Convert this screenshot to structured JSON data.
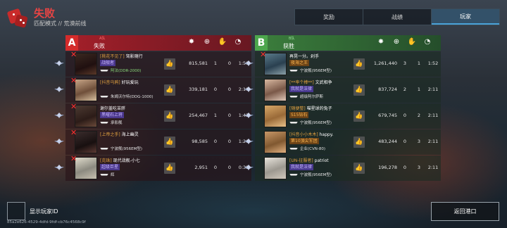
{
  "header": {
    "title": "失败",
    "subtitle": "匹配模式 // 荒漠前线"
  },
  "tabs": [
    {
      "label": "奖励",
      "active": false
    },
    {
      "label": "战绩",
      "active": false
    },
    {
      "label": "玩家",
      "active": true
    }
  ],
  "stat_icons": [
    "damage-icon",
    "kills-icon",
    "assists-icon",
    "survival-time-icon"
  ],
  "team_a": {
    "letter": "A",
    "tag": "A队",
    "result": "失败",
    "players": [
      {
        "clan": "[桃花不见了]",
        "name": "驾影随行",
        "title": "战舰者",
        "title_style": "purple",
        "ship": "阿法(DDR-2000)",
        "ship_green": true,
        "damage": "815,581",
        "kills": "1",
        "assists": "0",
        "time": "1:50",
        "dead": true
      },
      {
        "clan": "[抖音乌鸦]",
        "name": "好玩爱玩",
        "title": "",
        "title_style": "",
        "ship": "朱姆沃尔特(DDG-1000)",
        "ship_green": false,
        "damage": "339,181",
        "kills": "0",
        "assists": "0",
        "time": "2:10",
        "dead": true
      },
      {
        "clan": "",
        "name": "谢尔盖吃苦胖",
        "title": "黑曜石上将",
        "title_style": "purple",
        "ship": "承影舰",
        "ship_green": false,
        "damage": "254,467",
        "kills": "1",
        "assists": "0",
        "time": "1:43",
        "dead": true
      },
      {
        "clan": "[上帝之手]",
        "name": "海上幽灵",
        "title": "",
        "title_style": "",
        "ship": "宁波舰(956EM型)",
        "ship_green": false,
        "damage": "98,585",
        "kills": "0",
        "assists": "0",
        "time": "1:26",
        "dead": true
      },
      {
        "clan": "[克珠]",
        "name": "现代战舰-小七",
        "title": "超级巨星",
        "title_style": "purple",
        "ship": "辉",
        "ship_green": false,
        "damage": "2,951",
        "kills": "0",
        "assists": "0",
        "time": "0:39",
        "dead": true
      }
    ]
  },
  "team_b": {
    "letter": "B",
    "tag": "B队",
    "result": "获胜",
    "players": [
      {
        "clan": "",
        "name": "再晃一分。剁手",
        "title": "夜海之王",
        "title_style": "orange",
        "ship": "宁波舰(956EM型)",
        "ship_green": false,
        "damage": "1,261,440",
        "kills": "3",
        "assists": "1",
        "time": "1:52",
        "dead": true
      },
      {
        "clan": "[**率个棒**]",
        "name": "文武相争",
        "title": "我就是法律",
        "title_style": "purple",
        "ship": "超级阿尔萨斯",
        "ship_green": false,
        "damage": "837,724",
        "kills": "2",
        "assists": "1",
        "time": "2:11",
        "dead": false
      },
      {
        "clan": "[随便整]",
        "name": "喵星球的兔子",
        "title": "S15钻石",
        "title_style": "orange",
        "ship": "宁波舰(956EM型)",
        "ship_green": false,
        "damage": "679,745",
        "kills": "0",
        "assists": "2",
        "time": "2:11",
        "dead": false
      },
      {
        "clan": "[抖音小小木木]",
        "name": "happy.",
        "title": "第10頂尖军团",
        "title_style": "orange",
        "ship": "企业(CVN-80)",
        "ship_green": false,
        "damage": "483,244",
        "kills": "0",
        "assists": "3",
        "time": "2:11",
        "dead": false
      },
      {
        "clan": "[UN-征服者]",
        "name": "patriot",
        "title": "我就是法律",
        "title_style": "purple",
        "ship": "宁波舰(956EM型)",
        "ship_green": false,
        "damage": "196,278",
        "kills": "0",
        "assists": "3",
        "time": "2:11",
        "dead": false
      }
    ]
  },
  "footer": {
    "show_id_label": "显示玩家ID",
    "session_id": "85a2e626-4529-4dfd-9fdf-cb76c4568c9f",
    "return_label": "返回港口"
  }
}
